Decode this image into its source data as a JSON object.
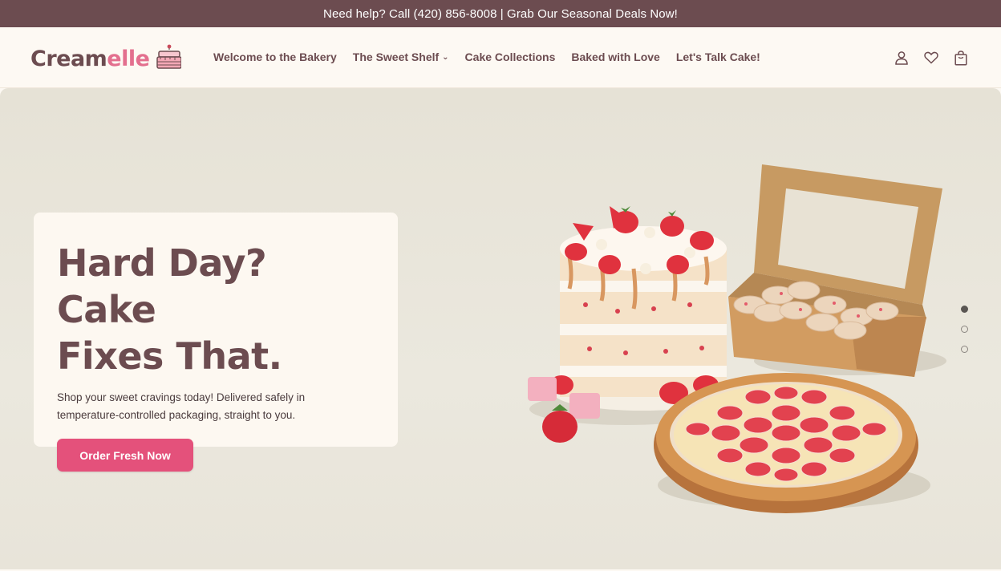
{
  "announcement": "Need help? Call (420) 856-8008 | Grab Our Seasonal Deals Now!",
  "brand": {
    "name_part1": "Cream",
    "name_part2": "elle",
    "logo_icon": "cake-icon"
  },
  "nav": {
    "items": [
      {
        "label": "Welcome to the Bakery"
      },
      {
        "label": "The Sweet Shelf",
        "has_dropdown": true
      },
      {
        "label": "Cake Collections"
      },
      {
        "label": "Baked with Love"
      },
      {
        "label": "Let's Talk Cake!"
      }
    ]
  },
  "header_icons": [
    "account-icon",
    "wishlist-heart-icon",
    "cart-bag-icon"
  ],
  "hero": {
    "headline": "Hard Day? Cake\nFixes That.",
    "subtext": "Shop your sweet cravings today! Delivered safely in temperature-controlled packaging, straight to you.",
    "cta_label": "Order Fresh Now",
    "slides": {
      "count": 3,
      "active_index": 0
    }
  },
  "colors": {
    "brand_brown": "#6c4c50",
    "brand_pink": "#e36f8e",
    "cta_pink": "#e4517b",
    "announcement_bg": "#6c4c50",
    "page_bg": "#fdf9f3"
  }
}
